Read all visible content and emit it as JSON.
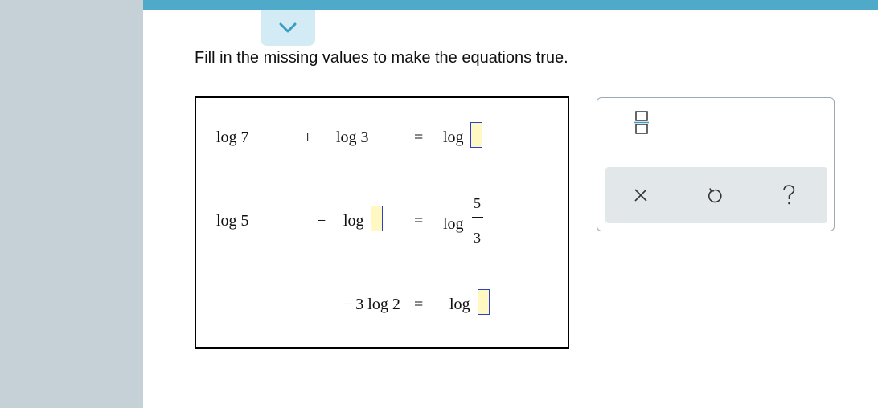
{
  "instruction": "Fill in the missing values to make the equations true.",
  "equations": [
    {
      "term1": "log 7",
      "operator": "+",
      "term2": "log 3",
      "equals": "=",
      "rhs": "log"
    },
    {
      "term1": "log 5",
      "operator": "−",
      "term2": "log",
      "equals": "=",
      "rhs": "log",
      "frac_numerator": "5",
      "frac_denominator": "3"
    },
    {
      "term1": "− 3 log 2",
      "equals": "=",
      "rhs": "log"
    }
  ],
  "answers": [
    "",
    "",
    ""
  ],
  "colors": {
    "sidebar": "#c5d1d7",
    "topbar": "#4fa9c8",
    "answer_fill": "#fff8c2",
    "answer_border": "#2b3fc7",
    "tray": "#e2e7ea"
  },
  "icons": {
    "collapse": "chevron-down-icon",
    "fraction": "fraction-template-icon",
    "clear": "close-icon",
    "undo": "undo-icon",
    "help": "help-icon"
  }
}
